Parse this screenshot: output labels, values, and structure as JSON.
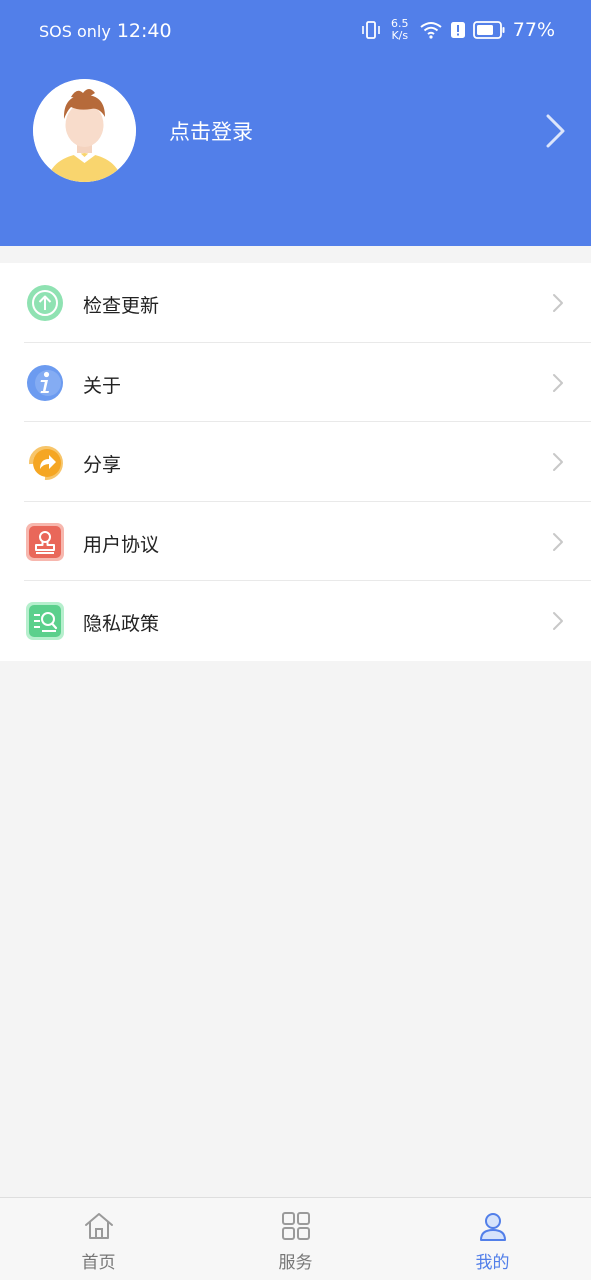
{
  "status_bar": {
    "carrier": "SOS only",
    "time": "12:40",
    "net_speed_value": "6.5",
    "net_speed_unit": "K/s",
    "battery_percent": "77%"
  },
  "header": {
    "login_label": "点击登录"
  },
  "menu": {
    "items": [
      {
        "label": "检查更新",
        "icon": "update-icon",
        "color": "#4fcf84"
      },
      {
        "label": "关于",
        "icon": "info-icon",
        "color": "#4e86e8"
      },
      {
        "label": "分享",
        "icon": "share-icon",
        "color": "#f5a623"
      },
      {
        "label": "用户协议",
        "icon": "agreement-icon",
        "color": "#e9675a"
      },
      {
        "label": "隐私政策",
        "icon": "privacy-icon",
        "color": "#4fcf84"
      }
    ]
  },
  "tabbar": {
    "tabs": [
      {
        "label": "首页",
        "icon": "home-icon"
      },
      {
        "label": "服务",
        "icon": "grid-icon"
      },
      {
        "label": "我的",
        "icon": "user-icon"
      }
    ],
    "active_tab": "我的"
  },
  "colors": {
    "accent": "#527fe9",
    "background": "#f4f4f4"
  }
}
